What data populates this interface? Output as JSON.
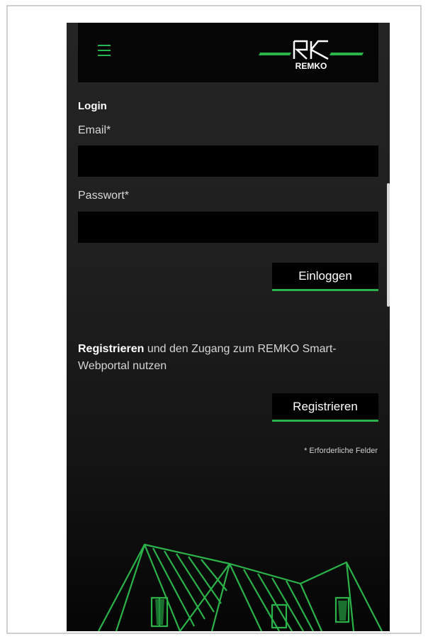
{
  "header": {
    "menu_icon": "hamburger-menu-icon",
    "logo_text": "REMKO",
    "accent_color": "#2bb34a"
  },
  "login": {
    "title": "Login",
    "email_label": "Email*",
    "email_value": "",
    "password_label": "Passwort*",
    "password_value": "",
    "submit_label": "Einloggen"
  },
  "register": {
    "bold_text": "Registrieren",
    "text": " und den Zugang zum REMKO Smart-Webportal nutzen",
    "button_label": "Registrieren"
  },
  "required_note": "* Erforderliche Felder",
  "illustration": "house-outline-illustration"
}
